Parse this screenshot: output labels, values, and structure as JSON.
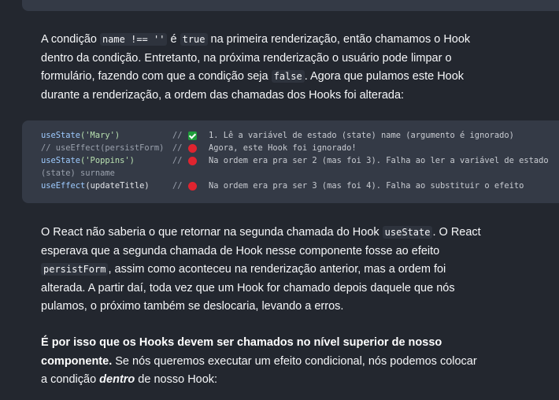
{
  "para1": {
    "t1": "A condição ",
    "c1": "name !== ''",
    "t2": " é ",
    "c2": "true",
    "t3": " na primeira renderização, então chamamos o Hook dentro da condição. Entretanto, na próxima renderização o usuário pode limpar o formulário, fazendo com que a condição seja ",
    "c3": "false",
    "t4": ". Agora que pulamos este Hook durante a renderização, a ordem das chamadas dos Hooks foi alterada:"
  },
  "code": {
    "lines": [
      {
        "fn": "useState",
        "args": "('Mary')",
        "comment": "//",
        "marker": "check-icon",
        "msg": "1. Lê a variável de estado (state) name (argumento é ignorado)"
      },
      {
        "fn": "// useEffect(persistForm)",
        "args": "",
        "comment": "//",
        "marker": "red-dot-icon",
        "msg": "Agora, este Hook foi ignorado!"
      },
      {
        "fn": "useState",
        "args": "('Poppins')",
        "comment": "//",
        "marker": "red-dot-icon",
        "msg": "Na ordem era pra ser 2 (mas foi 3). Falha ao ler a variável de estado"
      },
      {
        "wrap": "(state) surname"
      },
      {
        "fn": "useEffect",
        "args": "(updateTitle)",
        "comment": "//",
        "marker": "red-dot-icon",
        "msg": "Na ordem era pra ser 3 (mas foi 4). Falha ao substituir o efeito"
      }
    ]
  },
  "para2": {
    "t1": "O React não saberia o que retornar na segunda chamada do Hook ",
    "c1": "useState",
    "t2": ". O React esperava que a segunda chamada de Hook nesse componente fosse ao efeito ",
    "c2": "persistForm",
    "t3": ", assim como aconteceu na renderização anterior, mas a ordem foi alterada. A partir daí, toda vez que um Hook for chamado depois daquele que nós pulamos, o próximo também se deslocaria, levando a erros."
  },
  "para3": {
    "bold": "É por isso que os Hooks devem ser chamados no nível superior de nosso componente.",
    "t1": " Se nós queremos executar um efeito condicional, nós podemos colocar a condição ",
    "em": "dentro",
    "t2": " de nosso Hook:"
  }
}
